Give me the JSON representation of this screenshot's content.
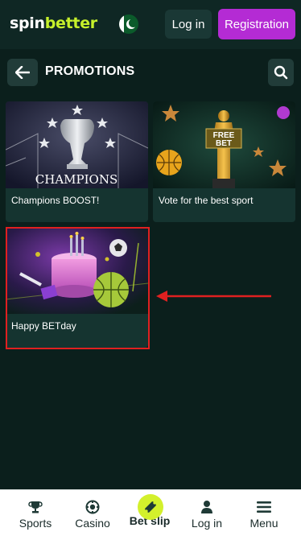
{
  "header": {
    "logo_part1": "spin",
    "logo_part2": "better",
    "login_label": "Log in",
    "register_label": "Registration"
  },
  "titlebar": {
    "title": "PROMOTIONS"
  },
  "promotions": [
    {
      "label": "Champions BOOST!",
      "image_text": "CHAMPIONS"
    },
    {
      "label": "Vote for the best sport",
      "image_text": "FREE BET"
    },
    {
      "label": "Happy BETday"
    }
  ],
  "bottom_nav": [
    {
      "label": "Sports",
      "icon": "trophy-icon"
    },
    {
      "label": "Casino",
      "icon": "casino-chip-icon"
    },
    {
      "label": "Bet slip",
      "icon": "ticket-icon"
    },
    {
      "label": "Log in",
      "icon": "user-icon"
    },
    {
      "label": "Menu",
      "icon": "menu-icon"
    }
  ],
  "colors": {
    "background": "#0b1f1c",
    "header": "#0f2724",
    "accent_green": "#c6f02b",
    "register_purple": "#b42bd4",
    "card": "#153430",
    "highlight_red": "#e02020"
  }
}
